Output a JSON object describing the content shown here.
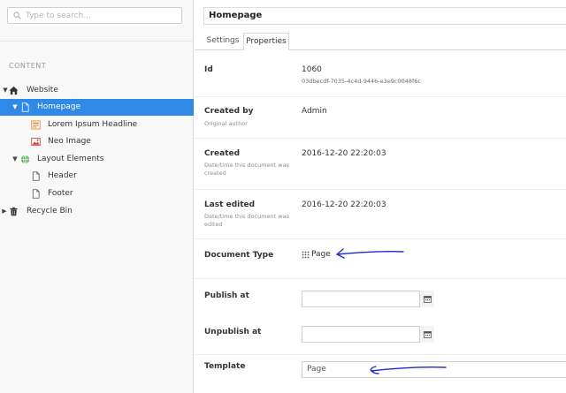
{
  "search": {
    "placeholder": "Type to search..."
  },
  "tree": {
    "section_title": "CONTENT",
    "nodes": [
      {
        "label": "Website",
        "icon": "home-icon"
      },
      {
        "label": "Homepage",
        "icon": "document-icon"
      },
      {
        "label": "Lorem Ipsum Headline",
        "icon": "headline-icon"
      },
      {
        "label": "Neo Image",
        "icon": "image-icon"
      },
      {
        "label": "Layout Elements",
        "icon": "globe-icon"
      },
      {
        "label": "Header",
        "icon": "document-icon"
      },
      {
        "label": "Footer",
        "icon": "document-icon"
      },
      {
        "label": "Recycle Bin",
        "icon": "trash-icon"
      }
    ]
  },
  "editor": {
    "name": "Homepage",
    "tabs": [
      "Settings",
      "Properties"
    ],
    "active_tab": "Properties"
  },
  "properties": {
    "id": {
      "label": "Id",
      "value": "1060",
      "guid": "03dbecdf-7035-4c4d-9446-e3e9c0048f6c"
    },
    "created_by": {
      "label": "Created by",
      "description": "Original author",
      "value": "Admin"
    },
    "created": {
      "label": "Created",
      "description": "Date/time this document was created",
      "value": "2016-12-20 22:20:03"
    },
    "last_edited": {
      "label": "Last edited",
      "description": "Date/time this document was edited",
      "value": "2016-12-20 22:20:03"
    },
    "document_type": {
      "label": "Document Type",
      "value": "Page"
    },
    "publish_at": {
      "label": "Publish at",
      "value": ""
    },
    "unpublish_at": {
      "label": "Unpublish at",
      "value": ""
    },
    "template": {
      "label": "Template",
      "value": "Page"
    }
  },
  "colors": {
    "selected": "#2e8ae6",
    "annotation": "#1a2ad6"
  }
}
